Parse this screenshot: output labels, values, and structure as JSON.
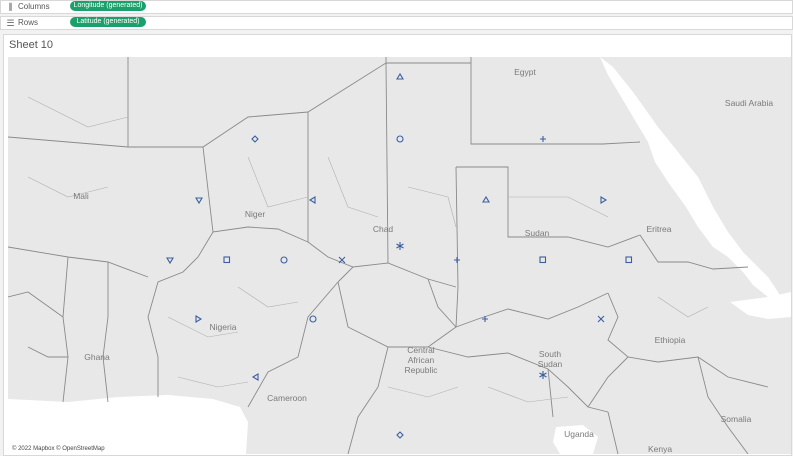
{
  "shelves": {
    "columns": {
      "icon": "columns-icon",
      "label": "Columns",
      "pill": "Longitude (generated)"
    },
    "rows": {
      "icon": "rows-icon",
      "label": "Rows",
      "pill": "Latitude (generated)"
    }
  },
  "sheet": {
    "title": "Sheet 10"
  },
  "map": {
    "attribution": "© 2022 Mapbox © OpenStreetMap",
    "colors": {
      "land": "#e8e8e8",
      "water": "#ffffff",
      "border": "#8a8a8a",
      "marker": "#3a5fa0",
      "pill": "#1aa16b"
    },
    "country_labels": [
      "Egypt",
      "Saudi Arabia",
      "Mali",
      "Niger",
      "Chad",
      "Sudan",
      "Eritrea",
      "Nigeria",
      "Ghana",
      "Central African Republic",
      "Ethiopia",
      "South Sudan",
      "Cameroon",
      "Somalia",
      "Uganda",
      "Kenya"
    ]
  },
  "chart_data": {
    "type": "scatter",
    "marker_shapes": [
      "triangle-up",
      "circle",
      "diamond",
      "plus",
      "triangle-down",
      "triangle-left",
      "triangle-right",
      "square",
      "cross",
      "asterisk"
    ]
  }
}
